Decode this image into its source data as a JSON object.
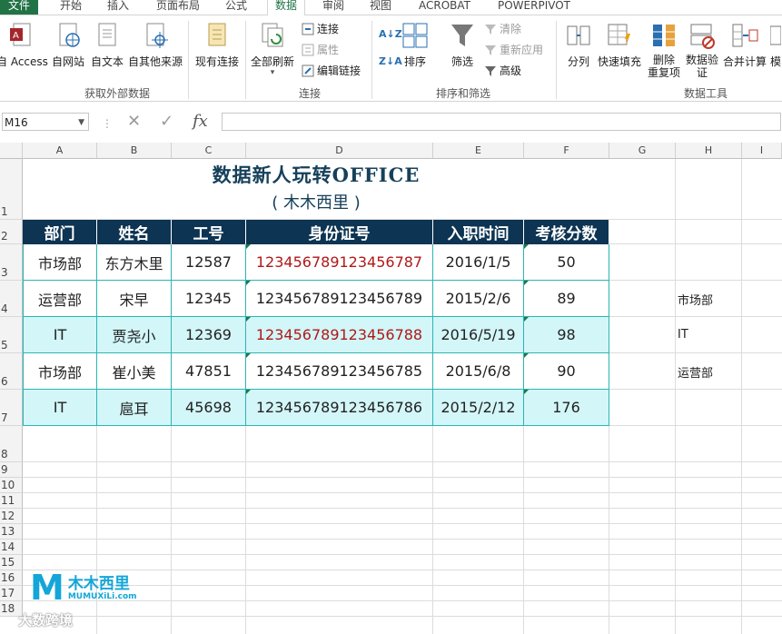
{
  "tabs": [
    "文件",
    "开始",
    "插入",
    "页面布局",
    "公式",
    "数据",
    "审阅",
    "视图",
    "ACROBAT",
    "POWERPIVOT"
  ],
  "active_tab": "数据",
  "ribbon": {
    "get_external": {
      "group_label": "获取外部数据",
      "buttons": [
        "自 Access",
        "自网站",
        "自文本",
        "自其他来源",
        "现有连接"
      ]
    },
    "connections": {
      "group_label": "连接",
      "refresh_all": "全部刷新",
      "small": [
        "连接",
        "属性",
        "编辑链接"
      ]
    },
    "sort_filter": {
      "group_label": "排序和筛选",
      "sort": "排序",
      "filter": "筛选",
      "small": [
        "清除",
        "重新应用",
        "高级"
      ]
    },
    "data_tools": {
      "group_label": "数据工具",
      "buttons": [
        "分列",
        "快速填充",
        "删除\n重复项",
        "数据验\n证",
        "合并计算",
        "模"
      ]
    }
  },
  "formula_bar": {
    "name_box": "M16",
    "cancel_icon": "✕",
    "enter_icon": "✓",
    "fx_label": "fx",
    "formula": ""
  },
  "sheet": {
    "columns": [
      "A",
      "B",
      "C",
      "D",
      "E",
      "F",
      "G",
      "H",
      "I"
    ],
    "rows": [
      "1",
      "2",
      "3",
      "4",
      "5",
      "6",
      "7",
      "8",
      "9",
      "10",
      "11",
      "12",
      "13",
      "14",
      "15",
      "16",
      "17",
      "18"
    ],
    "title": "数据新人玩转OFFICE",
    "subtitle": "( 木木西里 )",
    "headers": [
      "部门",
      "姓名",
      "工号",
      "身份证号",
      "入职时间",
      "考核分数"
    ],
    "data": [
      [
        "市场部",
        "东方木里",
        "12587",
        "123456789123456787",
        "2016/1/5",
        "50"
      ],
      [
        "运营部",
        "宋早",
        "12345",
        "123456789123456789",
        "2015/2/6",
        "89"
      ],
      [
        "IT",
        "贾尧小",
        "12369",
        "123456789123456788",
        "2016/5/19",
        "98"
      ],
      [
        "市场部",
        "崔小美",
        "47851",
        "123456789123456785",
        "2015/6/8",
        "90"
      ],
      [
        "IT",
        "扈耳",
        "45698",
        "123456789123456786",
        "2015/2/12",
        "176"
      ]
    ],
    "side_values": [
      "市场部",
      "IT",
      "运营部"
    ]
  },
  "watermark": {
    "logo_text": "木木西里",
    "logo_url_text": "MUMUXiLi.com",
    "overlay_text": "大数跨境"
  },
  "colors": {
    "header_fill": "#0d3452",
    "band_fill": "#d3f6f8",
    "border": "#2bb5b5",
    "duplicate_red": "#b01818",
    "excel_green": "#217346"
  }
}
